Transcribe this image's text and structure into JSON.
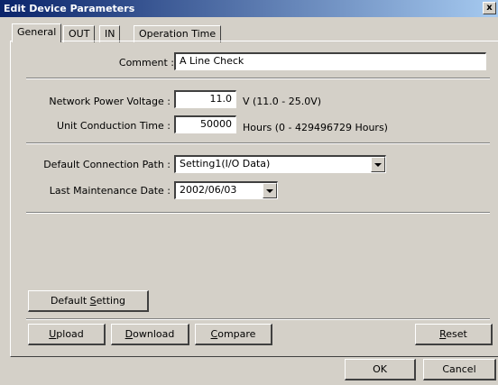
{
  "window": {
    "title": "Edit Device Parameters",
    "close_glyph": "x"
  },
  "tabs": [
    {
      "label": "General",
      "active": true
    },
    {
      "label": "OUT",
      "active": false
    },
    {
      "label": "IN",
      "active": false
    },
    {
      "label": "Operation Time",
      "active": false
    }
  ],
  "general": {
    "comment_label": "Comment :",
    "comment_value": "A Line Check",
    "voltage_label": "Network Power Voltage :",
    "voltage_value": "11.0",
    "voltage_range": "V (11.0 - 25.0V)",
    "conduction_label": "Unit Conduction Time :",
    "conduction_value": "50000",
    "conduction_range": "Hours (0 - 429496729 Hours)",
    "conn_path_label": "Default Connection Path :",
    "conn_path_value": "Setting1(I/O Data)",
    "maint_label": "Last Maintenance Date :",
    "maint_value": "2002/06/03",
    "default_setting_prefix": "Default ",
    "default_setting_ul": "S",
    "default_setting_rest": "etting"
  },
  "actions": {
    "upload_ul": "U",
    "upload_rest": "pload",
    "download_ul": "D",
    "download_rest": "ownload",
    "compare_ul": "C",
    "compare_rest": "ompare",
    "reset_ul": "R",
    "reset_rest": "eset"
  },
  "dialog": {
    "ok_label": "OK",
    "cancel_label": "Cancel"
  }
}
